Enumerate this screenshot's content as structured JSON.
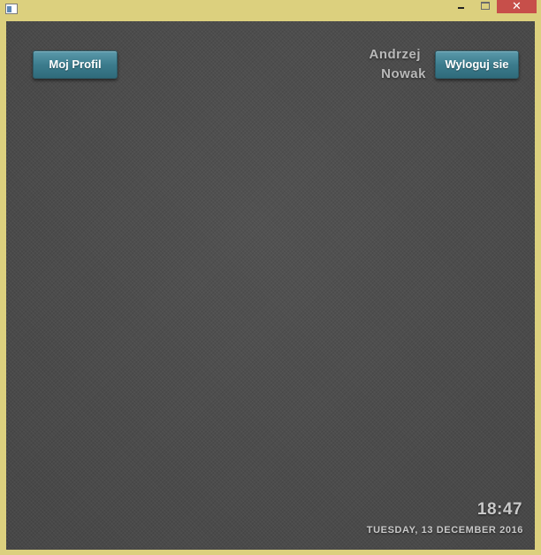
{
  "window": {
    "minimize_icon": "minimize-icon",
    "maximize_icon": "maximize-icon",
    "close_glyph": "✕",
    "frame_color": "#dcd07e",
    "close_color": "#c74f4a"
  },
  "header": {
    "profile_button": "Moj Profil",
    "user_first_name": "Andrzej",
    "user_last_name": "Nowak",
    "logout_button": "Wyloguj sie",
    "button_color": "#3c7c8d"
  },
  "footer": {
    "time": "18:47",
    "date": "TUESDAY, 13 DECEMBER 2016"
  },
  "background_color": "#4a4a4a"
}
